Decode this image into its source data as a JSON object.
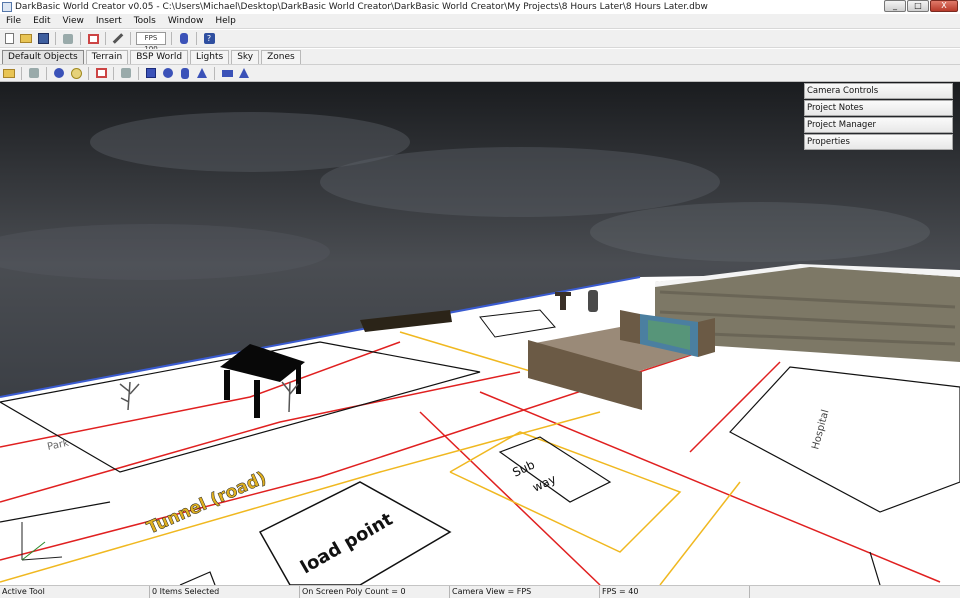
{
  "window": {
    "title": "DarkBasic World Creator v0.05 - C:\\Users\\Michael\\Desktop\\DarkBasic World Creator\\DarkBasic World Creator\\My Projects\\8 Hours Later\\8 Hours Later.dbw",
    "minimize": "_",
    "maximize": "□",
    "close": "X"
  },
  "menu": [
    "File",
    "Edit",
    "View",
    "Insert",
    "Tools",
    "Window",
    "Help"
  ],
  "toolbar": {
    "fps_box": "FPS 100",
    "help_glyph": "?"
  },
  "tabs": [
    "Default Objects",
    "Terrain",
    "BSP World",
    "Lights",
    "Sky",
    "Zones"
  ],
  "panel": [
    "Camera Controls",
    "Project Notes",
    "Project Manager",
    "Properties"
  ],
  "scene": {
    "labels": {
      "park": "Park",
      "tunnel": "Tunnel (road)",
      "load_point": "load point",
      "subway_line1": "Sub",
      "subway_line2": "way",
      "hospital": "Hospital"
    },
    "colors": {
      "sky_top": "#1a1c1f",
      "sky_mid": "#4a4d52",
      "ground": "#ffffff",
      "red_line": "#e02020",
      "yellow_line": "#f0b820",
      "outline": "#111111",
      "stone": "#7d7866",
      "wood": "#6b5a45"
    }
  },
  "status": [
    "Active Tool",
    "0 Items Selected",
    "On Screen Poly Count = 0",
    "Camera View = FPS",
    "FPS = 40"
  ]
}
